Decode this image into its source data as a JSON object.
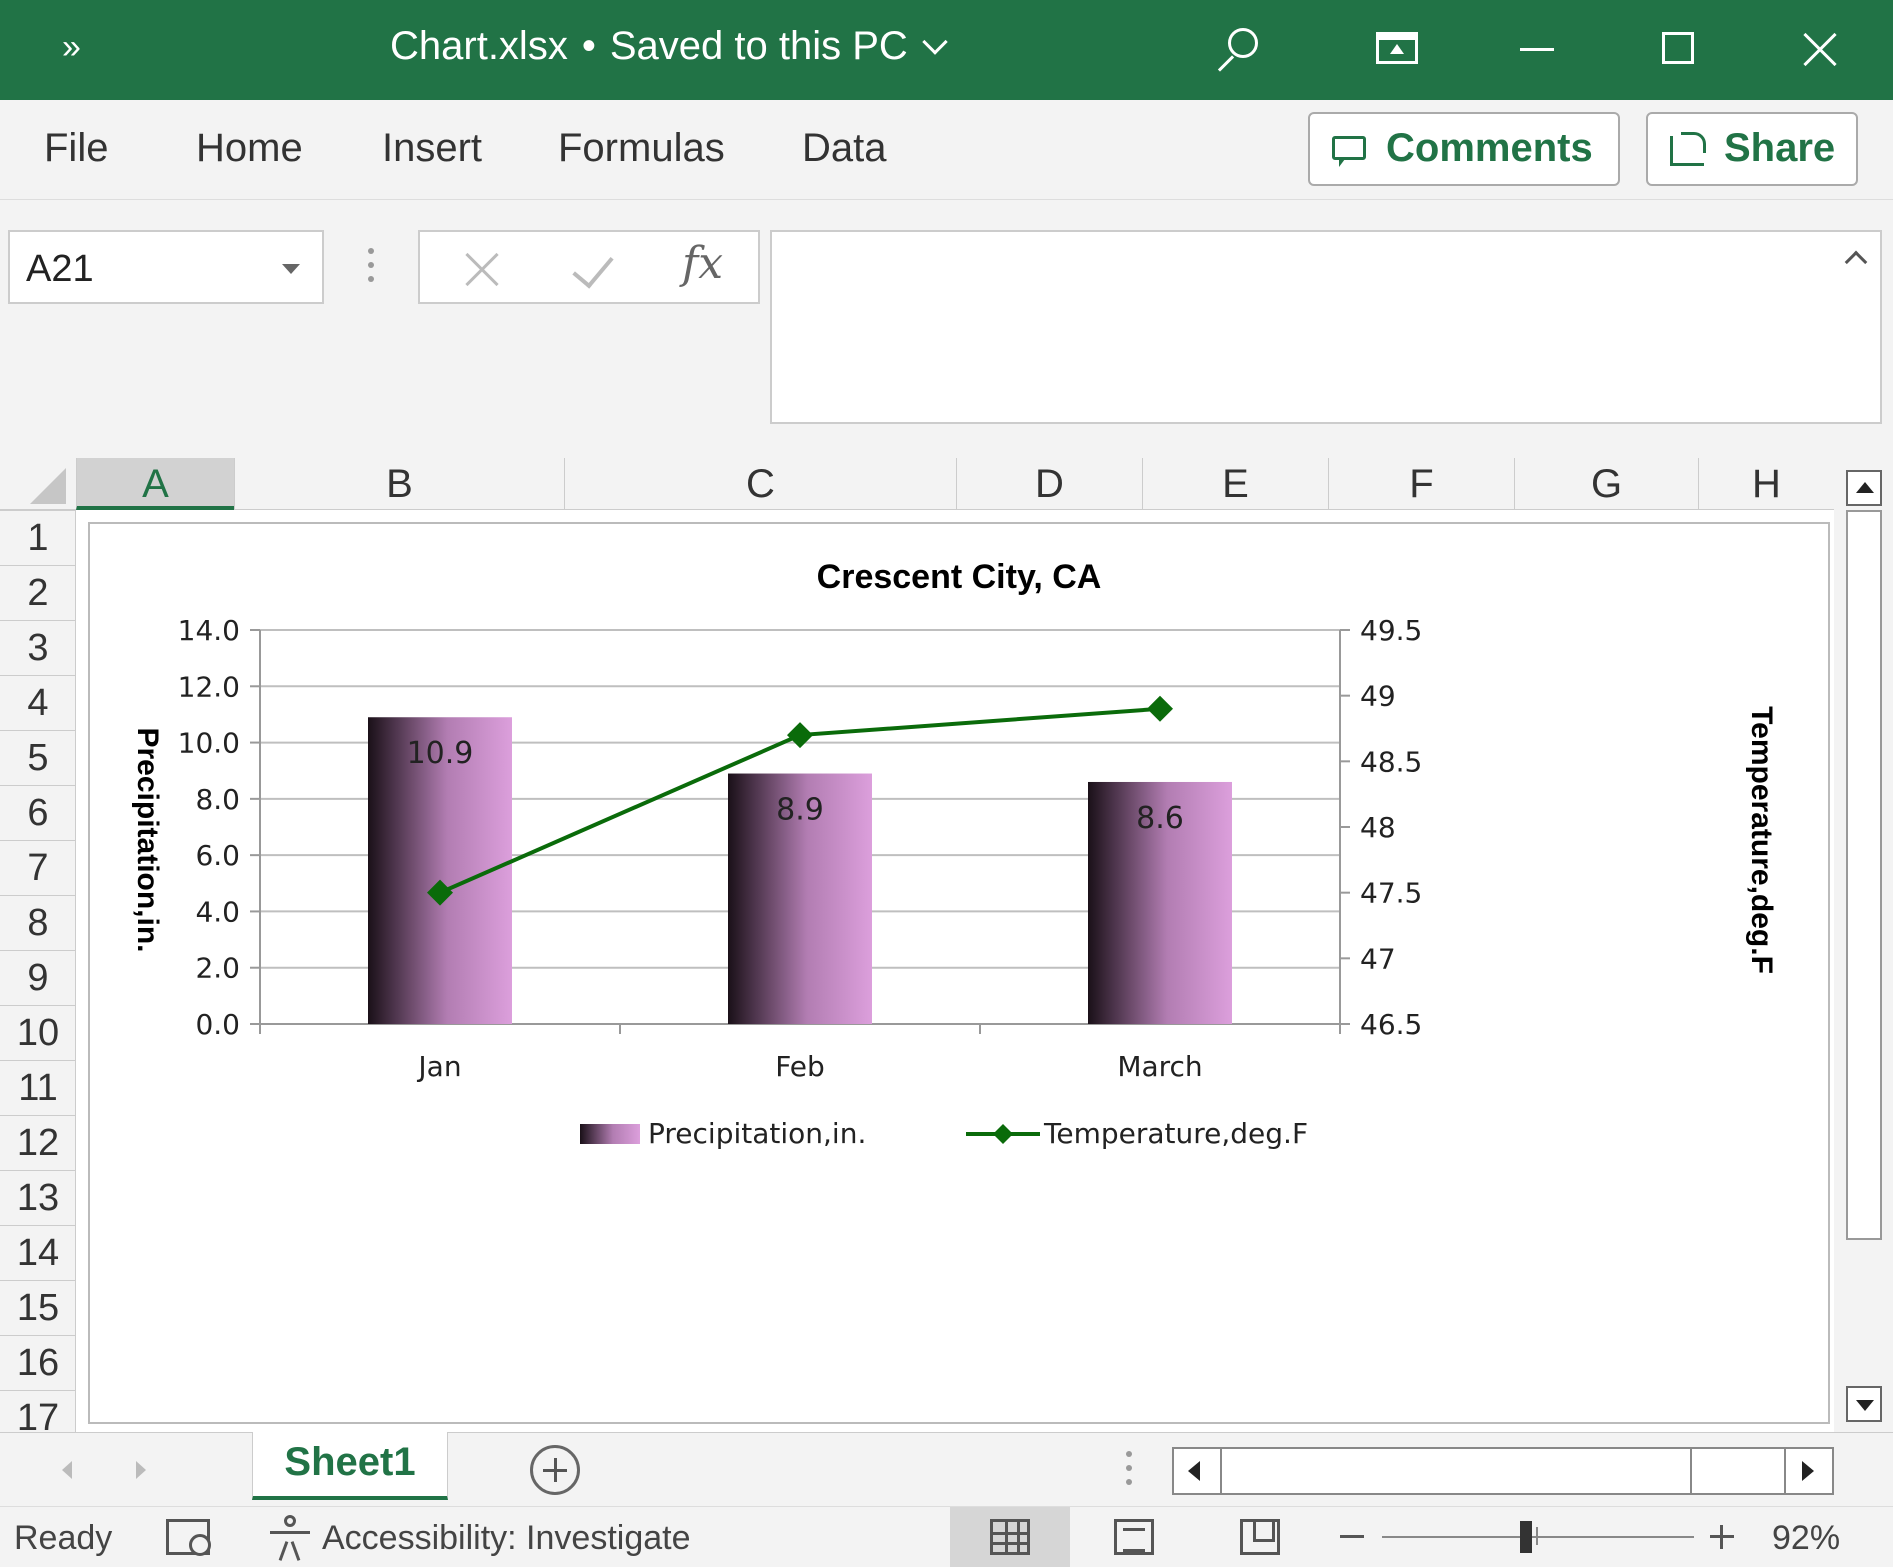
{
  "titlebar": {
    "more": "»",
    "filename": "Chart.xlsx",
    "separator": "•",
    "save_status": "Saved to this PC"
  },
  "ribbon": {
    "tabs": [
      "File",
      "Home",
      "Insert",
      "Formulas",
      "Data"
    ],
    "comments_label": "Comments",
    "share_label": "Share"
  },
  "formula_bar": {
    "name_box": "A21",
    "fx_label": "fx",
    "formula": ""
  },
  "grid": {
    "columns": [
      "A",
      "B",
      "C",
      "D",
      "E",
      "F",
      "G",
      "H"
    ],
    "selected_column": "A",
    "rows": [
      "1",
      "2",
      "3",
      "4",
      "5",
      "6",
      "7",
      "8",
      "9",
      "10",
      "11",
      "12",
      "13",
      "14",
      "15",
      "16",
      "17"
    ]
  },
  "chart_data": {
    "type": "bar",
    "title": "Crescent City, CA",
    "categories": [
      "Jan",
      "Feb",
      "March"
    ],
    "series": [
      {
        "name": "Precipitation,in.",
        "type": "bar",
        "axis": "primary",
        "values": [
          10.9,
          8.9,
          8.6
        ],
        "data_labels": [
          "10.9",
          "8.9",
          "8.6"
        ],
        "gradient": [
          "#1a1018",
          "#dc9fdc"
        ]
      },
      {
        "name": "Temperature,deg.F",
        "type": "line",
        "axis": "secondary",
        "values": [
          47.5,
          48.7,
          48.9
        ],
        "color": "#0a6b0a",
        "marker": "diamond"
      }
    ],
    "ylabel": "Precipitation,in.",
    "y2label": "Temperature,deg.F",
    "ylim": [
      0,
      14
    ],
    "y_ticks": [
      "0.0",
      "2.0",
      "4.0",
      "6.0",
      "8.0",
      "10.0",
      "12.0",
      "14.0"
    ],
    "y2lim": [
      46.5,
      49.5
    ],
    "y2_ticks": [
      "46.5",
      "47",
      "47.5",
      "48",
      "48.5",
      "49",
      "49.5"
    ],
    "grid": true,
    "legend": "bottom"
  },
  "sheets": {
    "active": "Sheet1"
  },
  "statusbar": {
    "ready": "Ready",
    "accessibility": "Accessibility: Investigate",
    "zoom": "92%",
    "zoom_fraction": 0.46
  },
  "colors": {
    "accent": "#217346"
  }
}
